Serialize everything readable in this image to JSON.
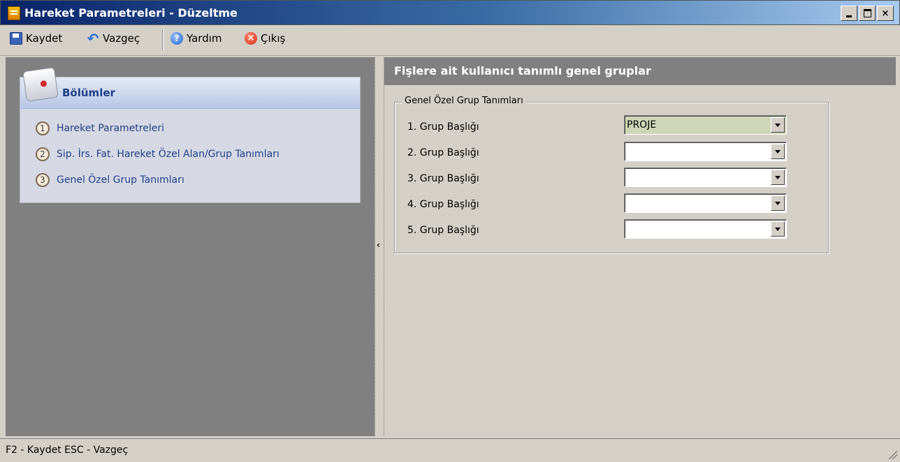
{
  "window": {
    "title": "Hareket Parametreleri - Düzeltme",
    "controls": {
      "minimize": "_",
      "maximize": "□",
      "close": "×"
    }
  },
  "toolbar": {
    "save_label": "Kaydet",
    "cancel_label": "Vazgeç",
    "help_label": "Yardım",
    "exit_label": "Çıkış"
  },
  "sections": {
    "title": "Bölümler",
    "items": [
      {
        "number": "1",
        "label": "Hareket Parametreleri"
      },
      {
        "number": "2",
        "label": "Sip. İrs. Fat. Hareket Özel Alan/Grup Tanımları"
      },
      {
        "number": "3",
        "label": "Genel Özel Grup Tanımları"
      }
    ]
  },
  "panel": {
    "header": "Fişlere ait kullanıcı tanımlı genel gruplar",
    "groupbox_title": "Genel Özel Grup Tanımları",
    "rows": [
      {
        "label": "1. Grup Başlığı",
        "value": "PROJE"
      },
      {
        "label": "2. Grup Başlığı",
        "value": ""
      },
      {
        "label": "3. Grup Başlığı",
        "value": ""
      },
      {
        "label": "4. Grup Başlığı",
        "value": ""
      },
      {
        "label": "5. Grup Başlığı",
        "value": ""
      }
    ]
  },
  "statusbar": {
    "text": "F2 - Kaydet  ESC - Vazgeç"
  },
  "colors": {
    "title_gradient_start": "#0a246a",
    "pane_gray": "#808080",
    "selected_field": "#cfd6b8",
    "link_blue": "#1f3f86"
  }
}
